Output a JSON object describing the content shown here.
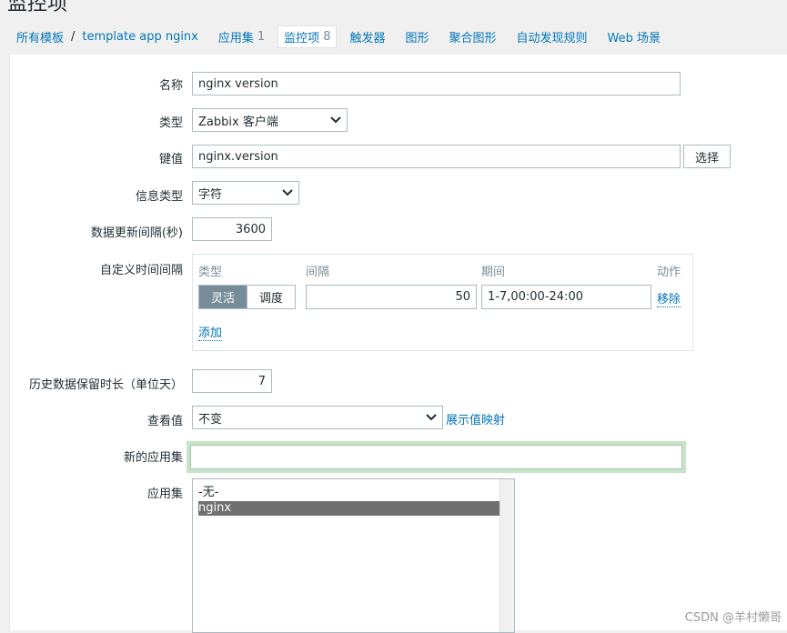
{
  "page_title": "监控项",
  "breadcrumb": {
    "root": "所有模板",
    "current": "template app nginx"
  },
  "tabs": [
    {
      "label": "应用集",
      "count": "1"
    },
    {
      "label": "监控项",
      "count": "8"
    },
    {
      "label": "触发器",
      "count": ""
    },
    {
      "label": "图形",
      "count": ""
    },
    {
      "label": "聚合图形",
      "count": ""
    },
    {
      "label": "自动发现规则",
      "count": ""
    },
    {
      "label": "Web 场景",
      "count": ""
    }
  ],
  "form": {
    "name_label": "名称",
    "name_value": "nginx version",
    "type_label": "类型",
    "type_value": "Zabbix 客户端",
    "key_label": "键值",
    "key_value": "nginx.version",
    "key_select_button": "选择",
    "info_type_label": "信息类型",
    "info_type_value": "字符",
    "update_interval_label": "数据更新间隔(秒)",
    "update_interval_value": "3600",
    "custom_intervals_label": "自定义时间间隔",
    "custom_intervals": {
      "col_type": "类型",
      "col_interval": "间隔",
      "col_period": "期间",
      "col_action": "动作",
      "mode_flexible": "灵活",
      "mode_scheduling": "调度",
      "interval_value": "50",
      "period_value": "1-7,00:00-24:00",
      "remove_link": "移除",
      "add_link": "添加"
    },
    "history_label": "历史数据保留时长（单位天）",
    "history_value": "7",
    "show_value_label": "查看值",
    "show_value_value": "不变",
    "show_value_mapping_link": "展示值映射",
    "new_application_label": "新的应用集",
    "new_application_value": "",
    "applications_label": "应用集",
    "applications_options": [
      "-无-",
      "nginx"
    ]
  },
  "watermark": "CSDN @羊村懒哥"
}
